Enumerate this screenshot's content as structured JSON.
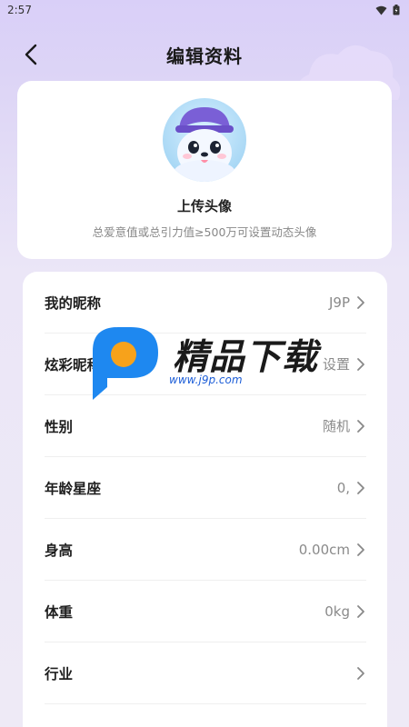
{
  "status_bar": {
    "time": "2:57"
  },
  "header": {
    "title": "编辑资料"
  },
  "avatar_section": {
    "upload_label": "上传头像",
    "hint": "总爱意值或总引力值≥500万可设置动态头像"
  },
  "profile_rows": [
    {
      "label": "我的昵称",
      "value": "J9P"
    },
    {
      "label": "炫彩昵称",
      "value": "设置"
    },
    {
      "label": "性别",
      "value": "随机"
    },
    {
      "label": "年龄星座",
      "value": "0,"
    },
    {
      "label": "身高",
      "value": "0.00cm"
    },
    {
      "label": "体重",
      "value": "0kg"
    },
    {
      "label": "行业",
      "value": ""
    }
  ],
  "watermark": {
    "text": "精品下载",
    "url": "www.j9p.com"
  },
  "colors": {
    "accent": "#8c7fe6",
    "brand_blue": "#1e88f0",
    "brand_orange": "#f7a21b"
  }
}
